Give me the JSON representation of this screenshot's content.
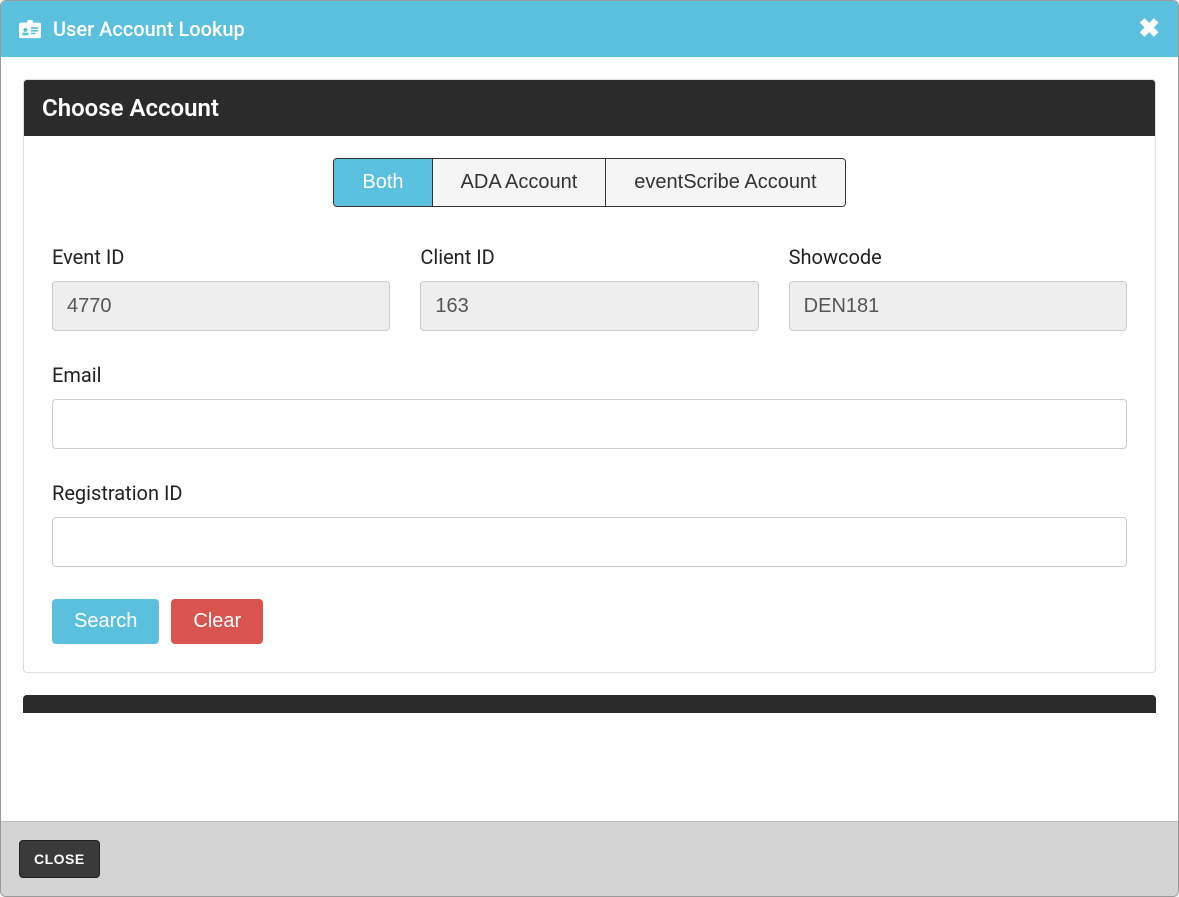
{
  "header": {
    "title": "User Account Lookup"
  },
  "panel": {
    "title": "Choose Account"
  },
  "tabs": {
    "both": "Both",
    "ada": "ADA Account",
    "escribe": "eventScribe Account"
  },
  "fields": {
    "event_id": {
      "label": "Event ID",
      "value": "4770"
    },
    "client_id": {
      "label": "Client ID",
      "value": "163"
    },
    "showcode": {
      "label": "Showcode",
      "value": "DEN181"
    },
    "email": {
      "label": "Email",
      "value": ""
    },
    "registration_id": {
      "label": "Registration ID",
      "value": ""
    }
  },
  "buttons": {
    "search": "Search",
    "clear": "Clear",
    "close": "CLOSE"
  }
}
